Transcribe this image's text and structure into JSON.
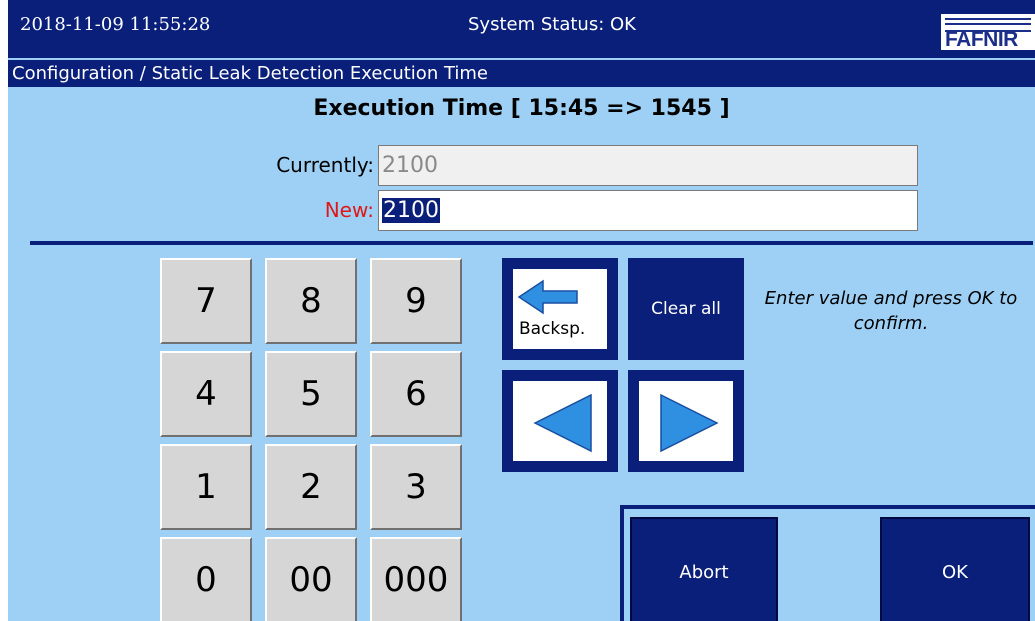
{
  "header": {
    "datetime": "2018-11-09  11:55:28",
    "status": "System Status: OK",
    "logo_text": "FAFNIR"
  },
  "breadcrumb": "Configuration / Static Leak Detection Execution Time",
  "title": "Execution Time [ 15:45 => 1545 ]",
  "fields": {
    "current_label": "Currently:",
    "current_value": "2100",
    "new_label": "New:",
    "new_value": "2100"
  },
  "keypad": {
    "keys": [
      "7",
      "8",
      "9",
      "4",
      "5",
      "6",
      "1",
      "2",
      "3",
      "0",
      "00",
      "000"
    ]
  },
  "controls": {
    "backspace_label": "Backsp.",
    "clear_all_label": "Clear all"
  },
  "hint": "Enter value and press OK to confirm.",
  "actions": {
    "abort_label": "Abort",
    "ok_label": "OK"
  },
  "colors": {
    "background": "#9dd0f4",
    "navy": "#0a1f7a",
    "arrow_blue": "#2f8fe0",
    "new_label_red": "#e01818"
  }
}
